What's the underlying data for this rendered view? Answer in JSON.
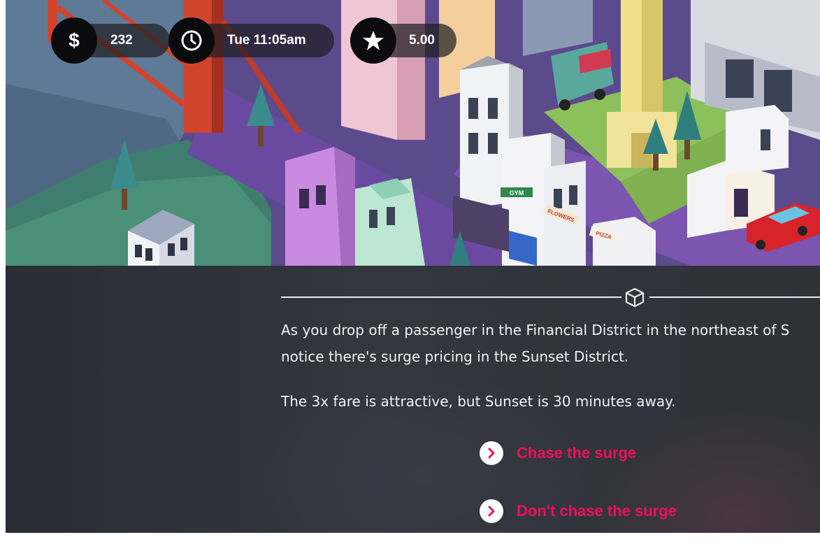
{
  "hud": {
    "money": {
      "icon": "dollar-icon",
      "value": "232"
    },
    "time": {
      "icon": "clock-icon",
      "value": "Tue 11:05am"
    },
    "rating": {
      "icon": "star-icon",
      "value": "5.00"
    }
  },
  "story": {
    "divider_icon": "cube-icon",
    "paragraph1_line1": "As you drop off a passenger in the Financial District in the northeast of S",
    "paragraph1_line2": "notice there's surge pricing in the Sunset District.",
    "paragraph2": "The 3x fare is attractive, but Sunset is 30 minutes away."
  },
  "choices": [
    {
      "label": "Chase the surge",
      "icon": "chevron-right-icon"
    },
    {
      "label": "Don't chase the surge",
      "icon": "chevron-right-icon"
    }
  ],
  "scene": {
    "signs": [
      "GYM",
      "FLOWERS",
      "PIZZA"
    ]
  },
  "colors": {
    "accent": "#f0105a",
    "panel_bg": "#2d3038",
    "hud_bg": "#0b0b0d",
    "text": "#f1f1f4"
  }
}
